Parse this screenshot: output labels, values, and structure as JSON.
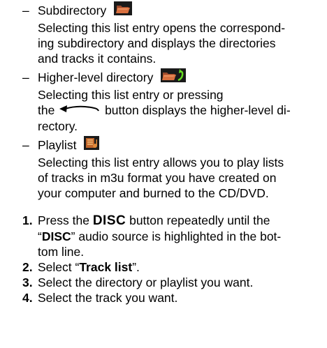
{
  "entries": [
    {
      "dash": "–",
      "title": "Subdirectory",
      "icon": "folder-icon",
      "description": [
        "Selecting this list entry opens the correspond-",
        "ing subdirectory and displays the directories",
        "and tracks it contains."
      ]
    },
    {
      "dash": "–",
      "title": "Higher-level directory",
      "icon": "folder-up-icon",
      "description_line1": "Selecting this list entry or pressing",
      "description_line2_before": "the",
      "description_line2_icon": "back-arrow-icon",
      "description_line2_after": "button displays the higher-level di-",
      "description_line3": "rectory."
    },
    {
      "dash": "–",
      "title": "Playlist",
      "icon": "playlist-icon",
      "description": [
        "Selecting this list entry allows you to play lists",
        "of tracks in m3u format you have created on",
        "your computer and burned to the CD/DVD."
      ]
    }
  ],
  "steps": [
    {
      "number": "1.",
      "text_before": "Press the",
      "button": "DISC",
      "text_after": "button repeatedly until the",
      "line2_open_quote": "“",
      "line2_source": "DISC",
      "line2_rest": "” audio source is highlighted in the bot-",
      "line3": "tom line."
    },
    {
      "number": "2.",
      "text_before": "Select “",
      "bold_text": "Track list",
      "text_after": "”."
    },
    {
      "number": "3.",
      "text": "Select the directory or playlist you want."
    },
    {
      "number": "4.",
      "text": "Select the track you want."
    }
  ]
}
